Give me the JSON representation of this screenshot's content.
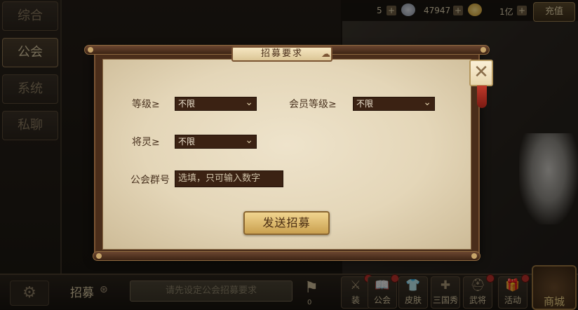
{
  "sidebar": {
    "tabs": [
      {
        "label": "综合",
        "active": false
      },
      {
        "label": "公会",
        "active": true
      },
      {
        "label": "系统",
        "active": false
      },
      {
        "label": "私聊",
        "active": false
      }
    ]
  },
  "resources": {
    "first": {
      "value": "5",
      "plus": "+"
    },
    "second": {
      "value": "47947",
      "plus": "+"
    },
    "third": {
      "value": "1亿",
      "plus": "+"
    },
    "recharge_label": "充值"
  },
  "bottom_bar": {
    "recruit_label": "招募",
    "recruit_icon": "⊛",
    "recruit_message": "请先设定公会招募要求",
    "flag_count": "0",
    "nav": [
      {
        "label": "装",
        "icon": "⚔",
        "badge": true
      },
      {
        "label": "公会",
        "icon": "📖",
        "badge": true
      },
      {
        "label": "皮肤",
        "icon": "👕",
        "badge": false
      },
      {
        "label": "三国秀",
        "icon": "✚",
        "badge": false
      },
      {
        "label": "武将",
        "icon": "⛑",
        "badge": true
      },
      {
        "label": "活动",
        "icon": "🎁",
        "badge": true
      }
    ],
    "store_label": "商城"
  },
  "modal": {
    "title": "招募要求",
    "close_icon": "✕",
    "level_label": "等级≥",
    "level_value": "不限",
    "member_level_label": "会员等级≥",
    "member_level_value": "不限",
    "general_spirit_label": "将灵≥",
    "general_spirit_value": "不限",
    "group_number_label": "公会群号",
    "group_number_placeholder": "选填，只可输入数字",
    "send_button": "发送招募"
  },
  "colors": {
    "parchment": "#e4d6b8",
    "frame": "#4a2d1a",
    "dropdown_bg": "#3b2213",
    "button_gold": "#d9b46a",
    "badge_red": "#b8312a"
  }
}
